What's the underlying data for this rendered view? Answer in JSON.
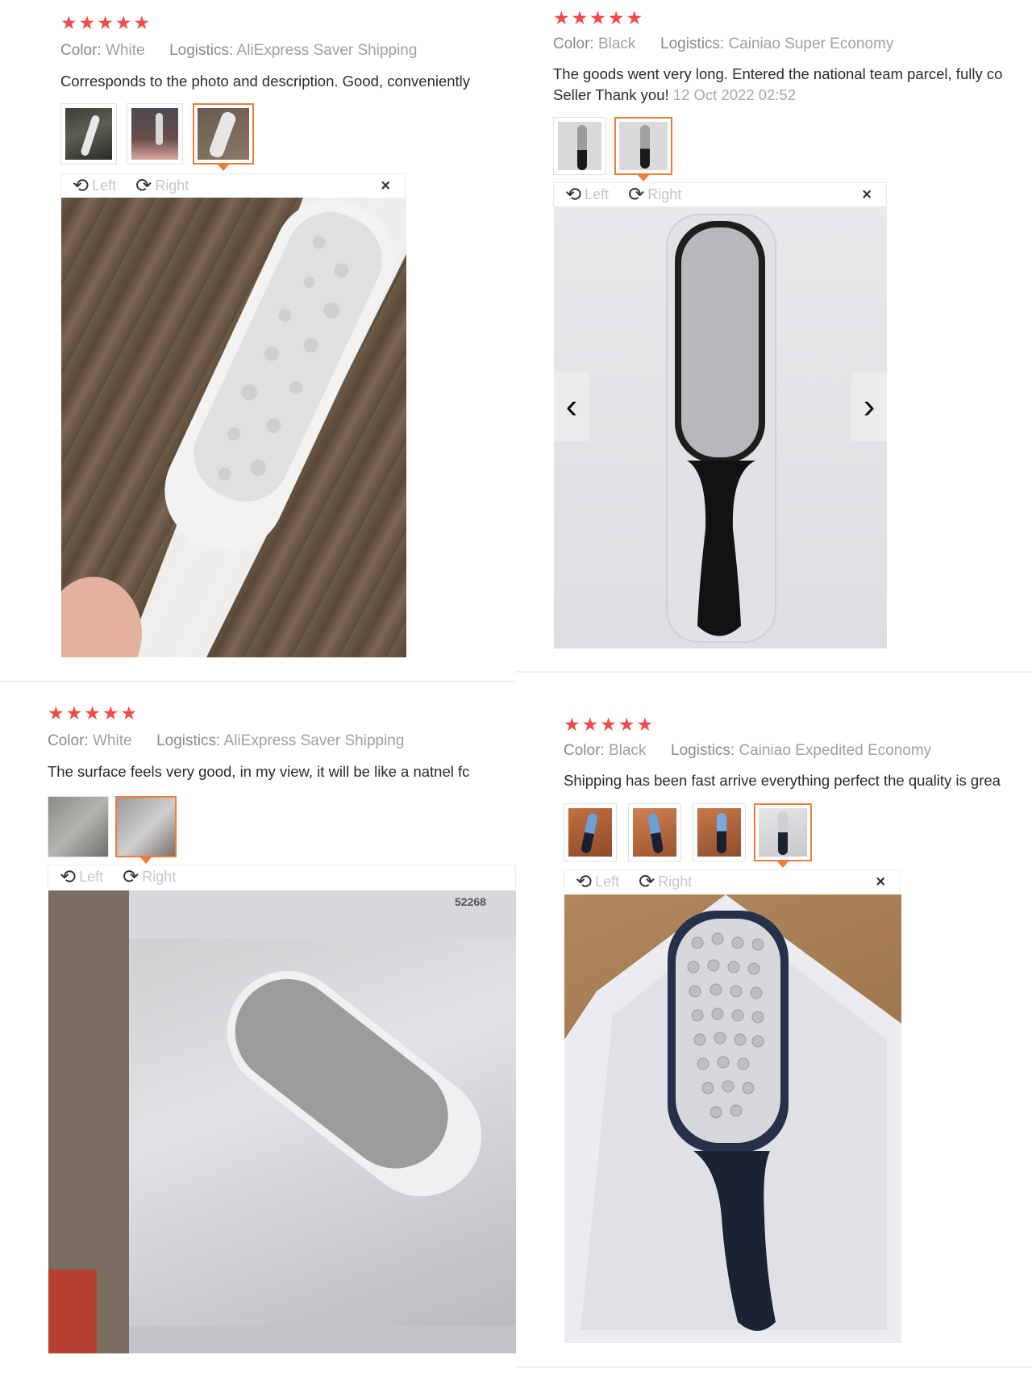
{
  "reviews": [
    {
      "stars": "★★★★★",
      "color_key": "Color:",
      "color_val": "White",
      "logistics_key": "Logistics:",
      "logistics_val": "AliExpress Saver Shipping",
      "text": "Corresponds to the photo and description. Good, conveniently",
      "viewer": {
        "left": "Left",
        "right": "Right",
        "close": "×"
      }
    },
    {
      "stars": "★★★★★",
      "color_key": "Color:",
      "color_val": "Black",
      "logistics_key": "Logistics:",
      "logistics_val": "Cainiao Super Economy",
      "text": "The goods went very long. Entered the national team parcel, fully co",
      "text2": "Seller Thank you!",
      "time": "12 Oct 2022 02:52",
      "viewer": {
        "left": "Left",
        "right": "Right",
        "close": "×",
        "prev": "‹",
        "next": "›"
      }
    },
    {
      "stars": "★★★★★",
      "color_key": "Color:",
      "color_val": "White",
      "logistics_key": "Logistics:",
      "logistics_val": "AliExpress Saver Shipping",
      "text": "The surface feels very good, in my view, it will be like a natnel fc",
      "photo_label": "52268",
      "viewer": {
        "left": "Left",
        "right": "Right"
      }
    },
    {
      "stars": "★★★★★",
      "color_key": "Color:",
      "color_val": "Black",
      "logistics_key": "Logistics:",
      "logistics_val": "Cainiao Expedited Economy",
      "text": "Shipping has been fast arrive everything perfect the quality is grea",
      "viewer": {
        "left": "Left",
        "right": "Right",
        "close": "×"
      }
    }
  ],
  "icons": {
    "rotate_left": "⟲",
    "rotate_right": "⟳"
  },
  "colors": {
    "star": "#f04a4a",
    "selected_border": "#f07c3a"
  }
}
